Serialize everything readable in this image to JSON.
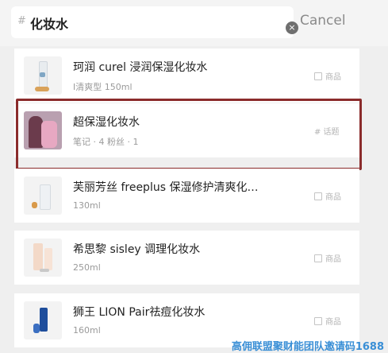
{
  "search": {
    "hash": "#",
    "query": "化妆水",
    "clear_icon": "×",
    "cancel_label": "Cancel"
  },
  "results": [
    {
      "title": "珂润 curel 浸润保湿化妆水",
      "subtitle": "I清爽型 150ml",
      "tag_label": "商品",
      "tag_icon": "product-box-icon"
    },
    {
      "title": "超保湿化妆水",
      "subtitle": "笔记 · 4  粉丝 · 1",
      "tag_label": "# 话题"
    },
    {
      "title": "芙丽芳丝 freeplus 保湿修护清爽化…",
      "subtitle": "130ml",
      "tag_label": "商品",
      "tag_icon": "product-box-icon"
    },
    {
      "title": "希思黎 sisley 调理化妆水",
      "subtitle": "250ml",
      "tag_label": "商品",
      "tag_icon": "product-box-icon"
    },
    {
      "title": "狮王 LION Pair祛痘化妆水",
      "subtitle": "160ml",
      "tag_label": "商品",
      "tag_icon": "product-box-icon"
    }
  ],
  "highlight_color": "#8b2c2c",
  "watermark": "高佣联盟聚财能团队邀请码1688"
}
